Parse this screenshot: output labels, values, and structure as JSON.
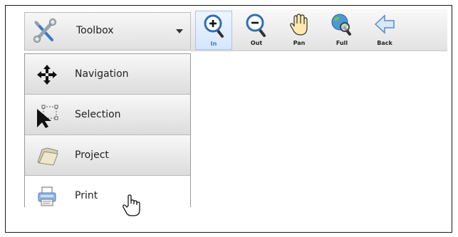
{
  "toolbox": {
    "title": "Toolbox",
    "items": [
      {
        "label": "Navigation",
        "icon": "move-arrows-icon"
      },
      {
        "label": "Selection",
        "icon": "select-arrow-icon"
      },
      {
        "label": "Project",
        "icon": "folder-icon"
      },
      {
        "label": "Print",
        "icon": "printer-icon"
      }
    ]
  },
  "toolbar": {
    "buttons": [
      {
        "label": "In",
        "icon": "zoom-in-icon",
        "active": true
      },
      {
        "label": "Out",
        "icon": "zoom-out-icon",
        "active": false
      },
      {
        "label": "Pan",
        "icon": "hand-pan-icon",
        "active": false
      },
      {
        "label": "Full",
        "icon": "globe-zoom-icon",
        "active": false
      },
      {
        "label": "Back",
        "icon": "back-arrow-icon",
        "active": false
      }
    ]
  },
  "colors": {
    "active_caption": "#2f7fd8",
    "zoom_ring": "#2e6fb5"
  }
}
